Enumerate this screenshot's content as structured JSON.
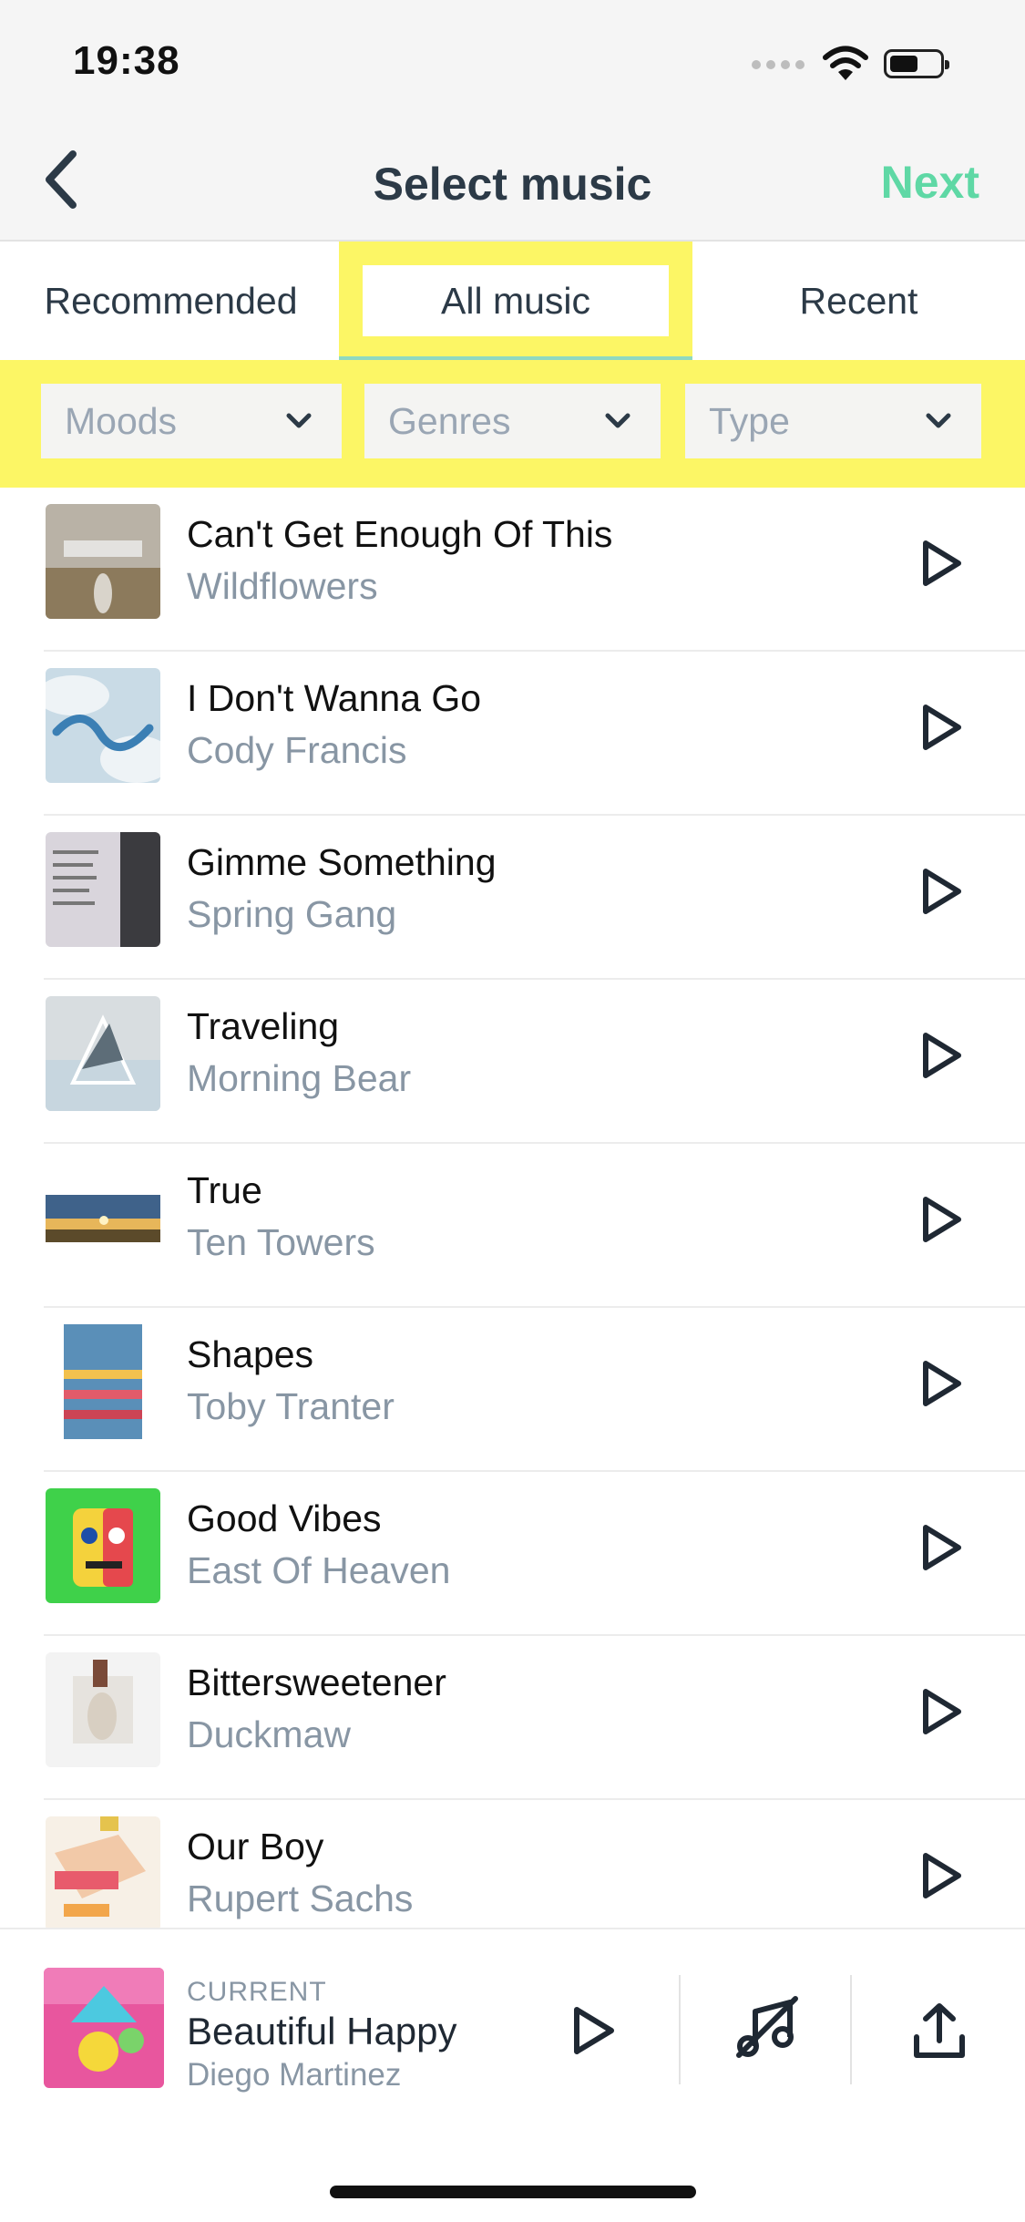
{
  "status": {
    "time": "19:38"
  },
  "nav": {
    "title": "Select music",
    "next_label": "Next"
  },
  "tabs": [
    {
      "label": "Recommended"
    },
    {
      "label": "All music",
      "selected": true
    },
    {
      "label": "Recent"
    }
  ],
  "filters": [
    {
      "label": "Moods"
    },
    {
      "label": "Genres"
    },
    {
      "label": "Type"
    }
  ],
  "tracks": [
    {
      "title": "Can't Get Enough Of This",
      "artist": "Wildflowers"
    },
    {
      "title": "I Don't Wanna Go",
      "artist": "Cody Francis"
    },
    {
      "title": "Gimme Something",
      "artist": "Spring Gang"
    },
    {
      "title": "Traveling",
      "artist": "Morning Bear"
    },
    {
      "title": "True",
      "artist": "Ten Towers"
    },
    {
      "title": "Shapes",
      "artist": "Toby Tranter"
    },
    {
      "title": "Good Vibes",
      "artist": "East Of Heaven"
    },
    {
      "title": "Bittersweetener",
      "artist": "Duckmaw"
    },
    {
      "title": "Our Boy",
      "artist": "Rupert Sachs"
    }
  ],
  "player": {
    "label": "CURRENT",
    "title": "Beautiful Happy",
    "artist": "Diego Martinez"
  },
  "colors": {
    "accent": "#5fd8a5",
    "highlight": "#fcf665",
    "text_dark": "#2c3a47",
    "text_muted": "#8896a4"
  }
}
